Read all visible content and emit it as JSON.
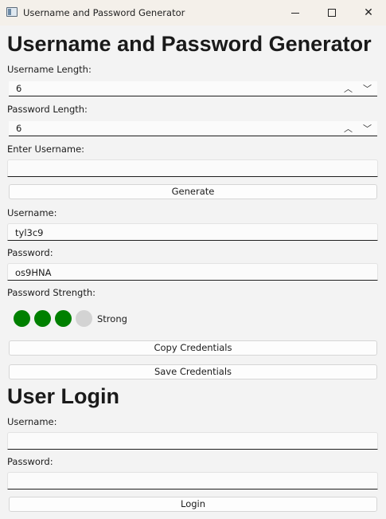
{
  "window": {
    "title": "Username and Password Generator"
  },
  "generator": {
    "heading": "Username and Password Generator",
    "username_length_label": "Username Length:",
    "username_length_value": "6",
    "password_length_label": "Password Length:",
    "password_length_value": "6",
    "enter_username_label": "Enter Username:",
    "enter_username_value": "",
    "generate_label": "Generate",
    "username_label": "Username:",
    "username_value": "tyl3c9",
    "password_label": "Password:",
    "password_value": "os9HNA",
    "strength_label": "Password Strength:",
    "strength": {
      "filled": 3,
      "total": 4,
      "text": "Strong",
      "filled_color": "#008000",
      "empty_color": "#d3d3d3"
    },
    "copy_label": "Copy Credentials",
    "save_label": "Save Credentials"
  },
  "login": {
    "heading": "User Login",
    "username_label": "Username:",
    "username_value": "",
    "password_label": "Password:",
    "password_value": "",
    "login_label": "Login"
  },
  "icons": {
    "spin_up": "chevron-up-icon",
    "spin_down": "chevron-down-icon"
  }
}
